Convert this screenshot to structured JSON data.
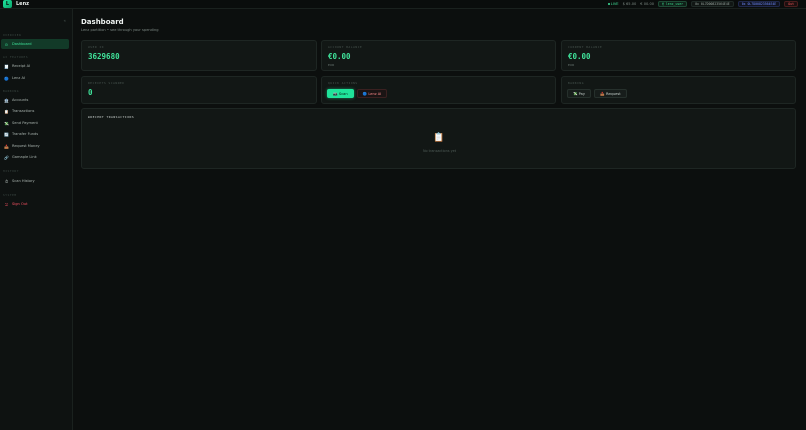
{
  "app": {
    "logo_letter": "L",
    "brand": "Lenz"
  },
  "topbar": {
    "live_label": "LIVE",
    "balances": [
      "$ 65.00",
      "€ 00.00"
    ],
    "user": "@ lenz_user",
    "address1": "0x 0L7D00823564E4E",
    "address2": "0x 0L7D00823564E4E",
    "logout": "Out"
  },
  "sidebar": {
    "collapse_glyph": "«",
    "sections": [
      {
        "title": "OVERVIEW",
        "items": [
          {
            "label": "Dashboard",
            "icon": "⊙",
            "active": true
          }
        ]
      },
      {
        "title": "AI FEATURES",
        "items": [
          {
            "label": "Receipt AI",
            "icon": "🧾"
          },
          {
            "label": "Lenz AI",
            "icon": "🔵"
          }
        ]
      },
      {
        "title": "BANKING",
        "items": [
          {
            "label": "Accounts",
            "icon": "🏦"
          },
          {
            "label": "Transactions",
            "icon": "📋"
          },
          {
            "label": "Send Payment",
            "icon": "💸"
          },
          {
            "label": "Transfer Funds",
            "icon": "🔄"
          },
          {
            "label": "Request Money",
            "icon": "📥"
          },
          {
            "label": "Gamaple Link",
            "icon": "🔗"
          }
        ]
      },
      {
        "title": "HISTORY",
        "items": [
          {
            "label": "Scan History",
            "icon": "⏱"
          }
        ]
      },
      {
        "title": "SYSTEM",
        "items": [
          {
            "label": "Sign Out",
            "icon": "⎋",
            "danger": true
          }
        ]
      }
    ]
  },
  "header": {
    "title": "Dashboard",
    "subtitle": "Lenz partition • see through your spending"
  },
  "cards": {
    "user_id": {
      "label": "USER ID",
      "value": "3629680"
    },
    "account_balance": {
      "label": "ACCOUNT BALANCE",
      "value": "€0.00",
      "unit": "EUR"
    },
    "current_balance": {
      "label": "CURRENT BALANCE",
      "value": "€0.00",
      "unit": "EUR"
    },
    "receipts_scanned": {
      "label": "RECEIPTS SCANNED",
      "value": "0"
    },
    "quick_actions": {
      "label": "QUICK ACTIONS",
      "scan": "📷 Scan",
      "lenz_ai": "🔵 Lenz AI"
    },
    "banking": {
      "label": "BANKING",
      "pay": "💸 Pay",
      "request": "📥 Request"
    }
  },
  "transactions": {
    "title": "▮RECENT TRANSACTIONS",
    "empty_icon": "📋",
    "empty_text": "No transactions yet"
  }
}
